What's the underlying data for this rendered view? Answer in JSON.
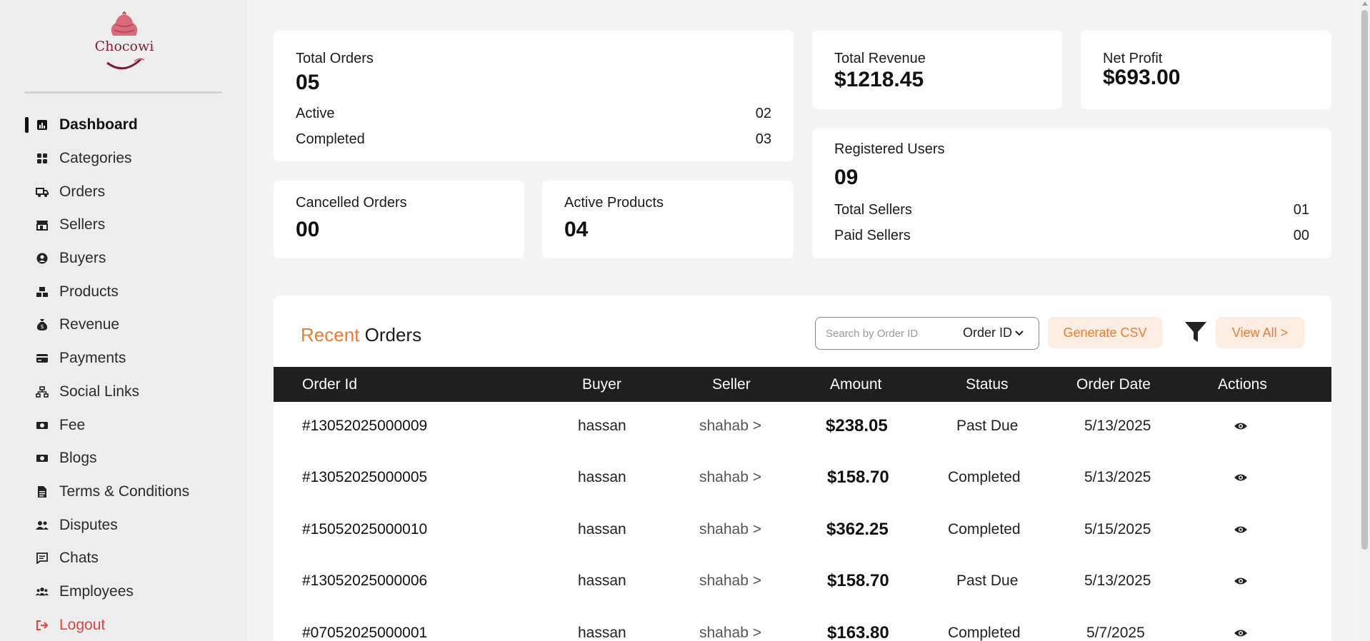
{
  "brand": {
    "name": "Chocowi"
  },
  "sidebar": {
    "items": [
      {
        "label": "Dashboard",
        "icon": "chart-icon"
      },
      {
        "label": "Categories",
        "icon": "grid-icon"
      },
      {
        "label": "Orders",
        "icon": "truck-icon"
      },
      {
        "label": "Sellers",
        "icon": "store-icon"
      },
      {
        "label": "Buyers",
        "icon": "user-circle-icon"
      },
      {
        "label": "Products",
        "icon": "boxes-icon"
      },
      {
        "label": "Revenue",
        "icon": "money-bag-icon"
      },
      {
        "label": "Payments",
        "icon": "credit-card-icon"
      },
      {
        "label": "Social Links",
        "icon": "network-icon"
      },
      {
        "label": "Fee",
        "icon": "cash-icon"
      },
      {
        "label": "Blogs",
        "icon": "cash-icon"
      },
      {
        "label": "Terms & Conditions",
        "icon": "document-icon"
      },
      {
        "label": "Disputes",
        "icon": "users-icon"
      },
      {
        "label": "Chats",
        "icon": "message-icon"
      },
      {
        "label": "Employees",
        "icon": "users-group-icon"
      },
      {
        "label": "Logout",
        "icon": "logout-icon"
      }
    ]
  },
  "stats": {
    "total_orders": {
      "title": "Total Orders",
      "value": "05",
      "active_label": "Active",
      "active_value": "02",
      "completed_label": "Completed",
      "completed_value": "03"
    },
    "total_revenue": {
      "title": "Total Revenue",
      "value": "$1218.45"
    },
    "net_profit": {
      "title": "Net Profit",
      "value": "$693.00"
    },
    "cancelled_orders": {
      "title": "Cancelled Orders",
      "value": "00"
    },
    "active_products": {
      "title": "Active Products",
      "value": "04"
    },
    "registered_users": {
      "title": "Registered Users",
      "value": "09",
      "sellers_label": "Total Sellers",
      "sellers_value": "01",
      "paid_label": "Paid Sellers",
      "paid_value": "00"
    }
  },
  "recent_orders": {
    "title_accent": "Recent",
    "title_rest": "Orders",
    "search_placeholder": "Search by Order ID",
    "search_by": "Order ID",
    "csv_label": "Generate CSV",
    "view_all_label": "View All >",
    "columns": [
      "Order Id",
      "Buyer",
      "Seller",
      "Amount",
      "Status",
      "Order Date",
      "Actions"
    ],
    "rows": [
      {
        "id": "#13052025000009",
        "buyer": "hassan",
        "seller": "shahab >",
        "amount": "$238.05",
        "status": "Past Due",
        "date": "5/13/2025"
      },
      {
        "id": "#13052025000005",
        "buyer": "hassan",
        "seller": "shahab >",
        "amount": "$158.70",
        "status": "Completed",
        "date": "5/13/2025"
      },
      {
        "id": "#15052025000010",
        "buyer": "hassan",
        "seller": "shahab >",
        "amount": "$362.25",
        "status": "Completed",
        "date": "5/15/2025"
      },
      {
        "id": "#13052025000006",
        "buyer": "hassan",
        "seller": "shahab >",
        "amount": "$158.70",
        "status": "Past Due",
        "date": "5/13/2025"
      },
      {
        "id": "#07052025000001",
        "buyer": "hassan",
        "seller": "shahab >",
        "amount": "$163.80",
        "status": "Completed",
        "date": "5/7/2025"
      }
    ]
  },
  "colors": {
    "accent": "#ea7d33",
    "logout": "#e8413a",
    "table_header": "#1f1f1f"
  }
}
